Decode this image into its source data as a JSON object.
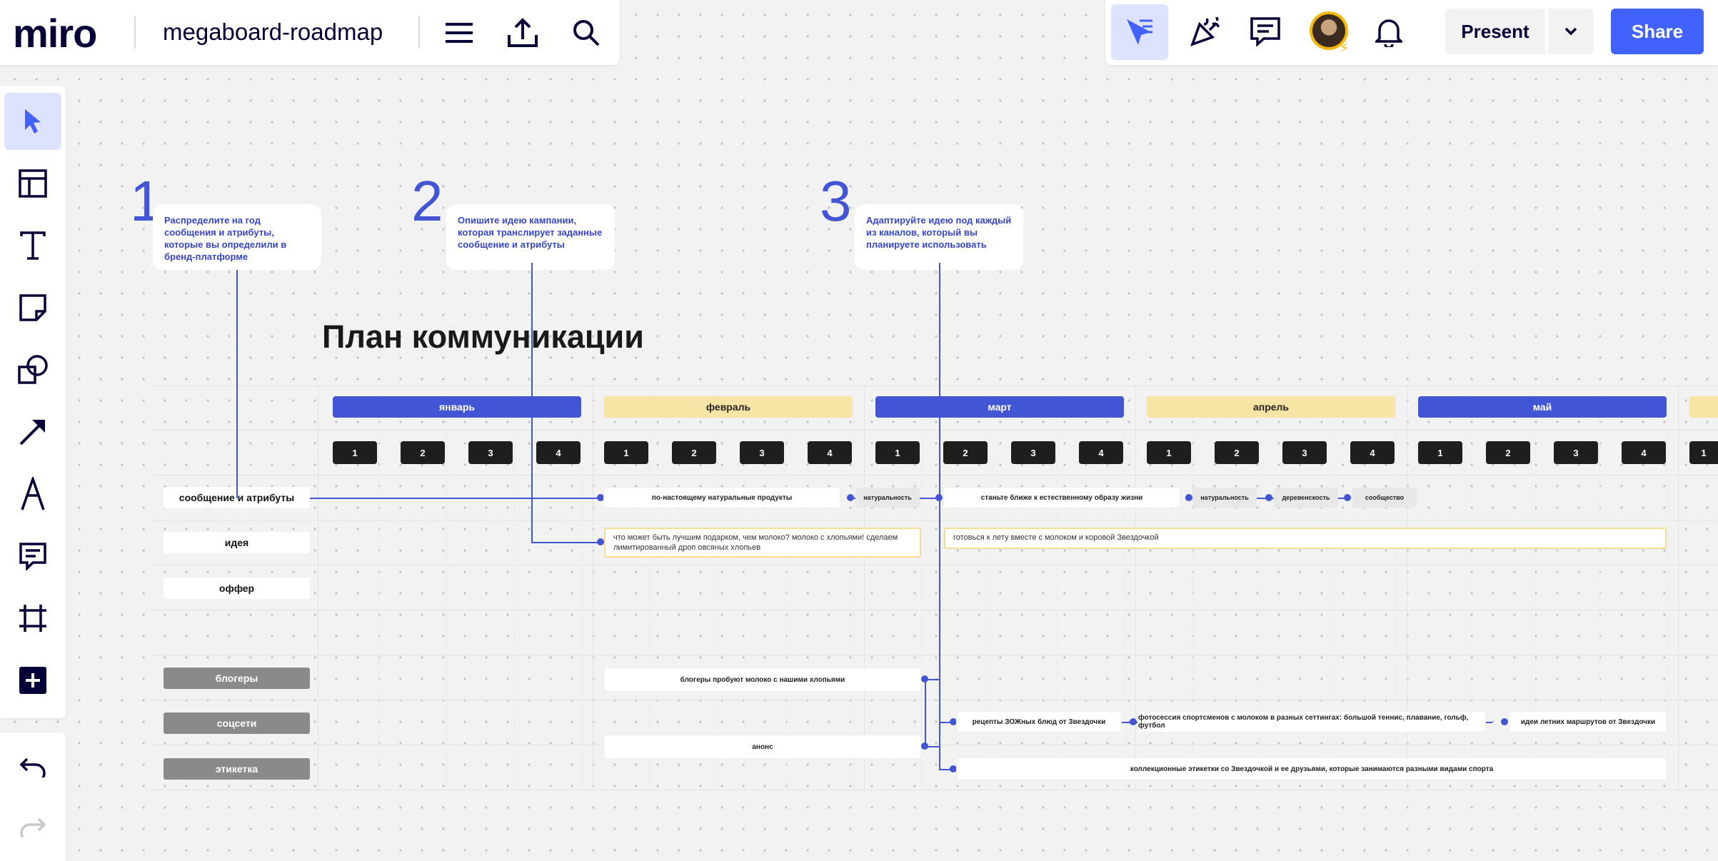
{
  "header": {
    "logo": "miro",
    "board_name": "megaboard-roadmap",
    "present_label": "Present",
    "share_label": "Share",
    "icons": [
      "menu-icon",
      "export-icon",
      "search-icon",
      "reactions-icon",
      "celebrate-icon",
      "comments-icon",
      "avatar",
      "bell-icon",
      "chevron-down-icon"
    ]
  },
  "toolbar": {
    "tools": [
      "select",
      "templates",
      "text",
      "sticky-note",
      "shapes",
      "arrow",
      "pen",
      "comment",
      "frame",
      "more"
    ],
    "undo": "undo-icon",
    "redo": "redo-icon"
  },
  "steps": [
    {
      "number": "1",
      "text": "Распределите на год сообщения и атрибуты, которые вы определили в бренд-платформе"
    },
    {
      "number": "2",
      "text": "Опишите идею кампании, которая транслирует заданные сообщение и атрибуты"
    },
    {
      "number": "3",
      "text": "Адаптируйте идею под каждый из каналов, который вы планируете использовать"
    }
  ],
  "plan": {
    "title": "План коммуникации",
    "months": [
      "январь",
      "февраль",
      "март",
      "апрель",
      "май"
    ],
    "weeks": [
      "1",
      "2",
      "3",
      "4"
    ],
    "row_labels": [
      "сообщение и атрибуты",
      "идея",
      "оффер",
      "блогеры",
      "соцсети",
      "этикетка"
    ],
    "messages": {
      "feb_main": "по-настоящему натуральные продукты",
      "feb_tag": "натуральность",
      "mar_main": "станьте ближе к естественному образу жизни",
      "apr_tags": [
        "натуральность",
        "деревенскость",
        "сообщество"
      ]
    },
    "ideas": {
      "feb": "что может быть лучшим подарком, чем молоко? молоко с хлопьями! сделаем лимитированный дроп овсяных хлопьев",
      "mar": "готовься к лету вместе с молоком и коровой Звездочкой"
    },
    "channels": {
      "bloggers_feb": "блогеры пробуют молоко с нашими хлопьями",
      "social_mar": "рецепты ЗОЖных блюд от Звездочки",
      "social_apr": "фотосессия спортсменов с молоком в разных сеттингах: большой теннис, плавание, гольф, футбол",
      "social_may": "идеи летних маршрутов от Звездочки",
      "label_feb": "анонс",
      "label_mar": "коллекционные этикетки со Звездочкой и ее друзьями, которые занимаются разными видами спорта"
    }
  },
  "colors": {
    "accent": "#4262ff",
    "month_blue": "#4255d4",
    "month_yellow": "#f8e5a6",
    "connector": "#4255d4"
  }
}
